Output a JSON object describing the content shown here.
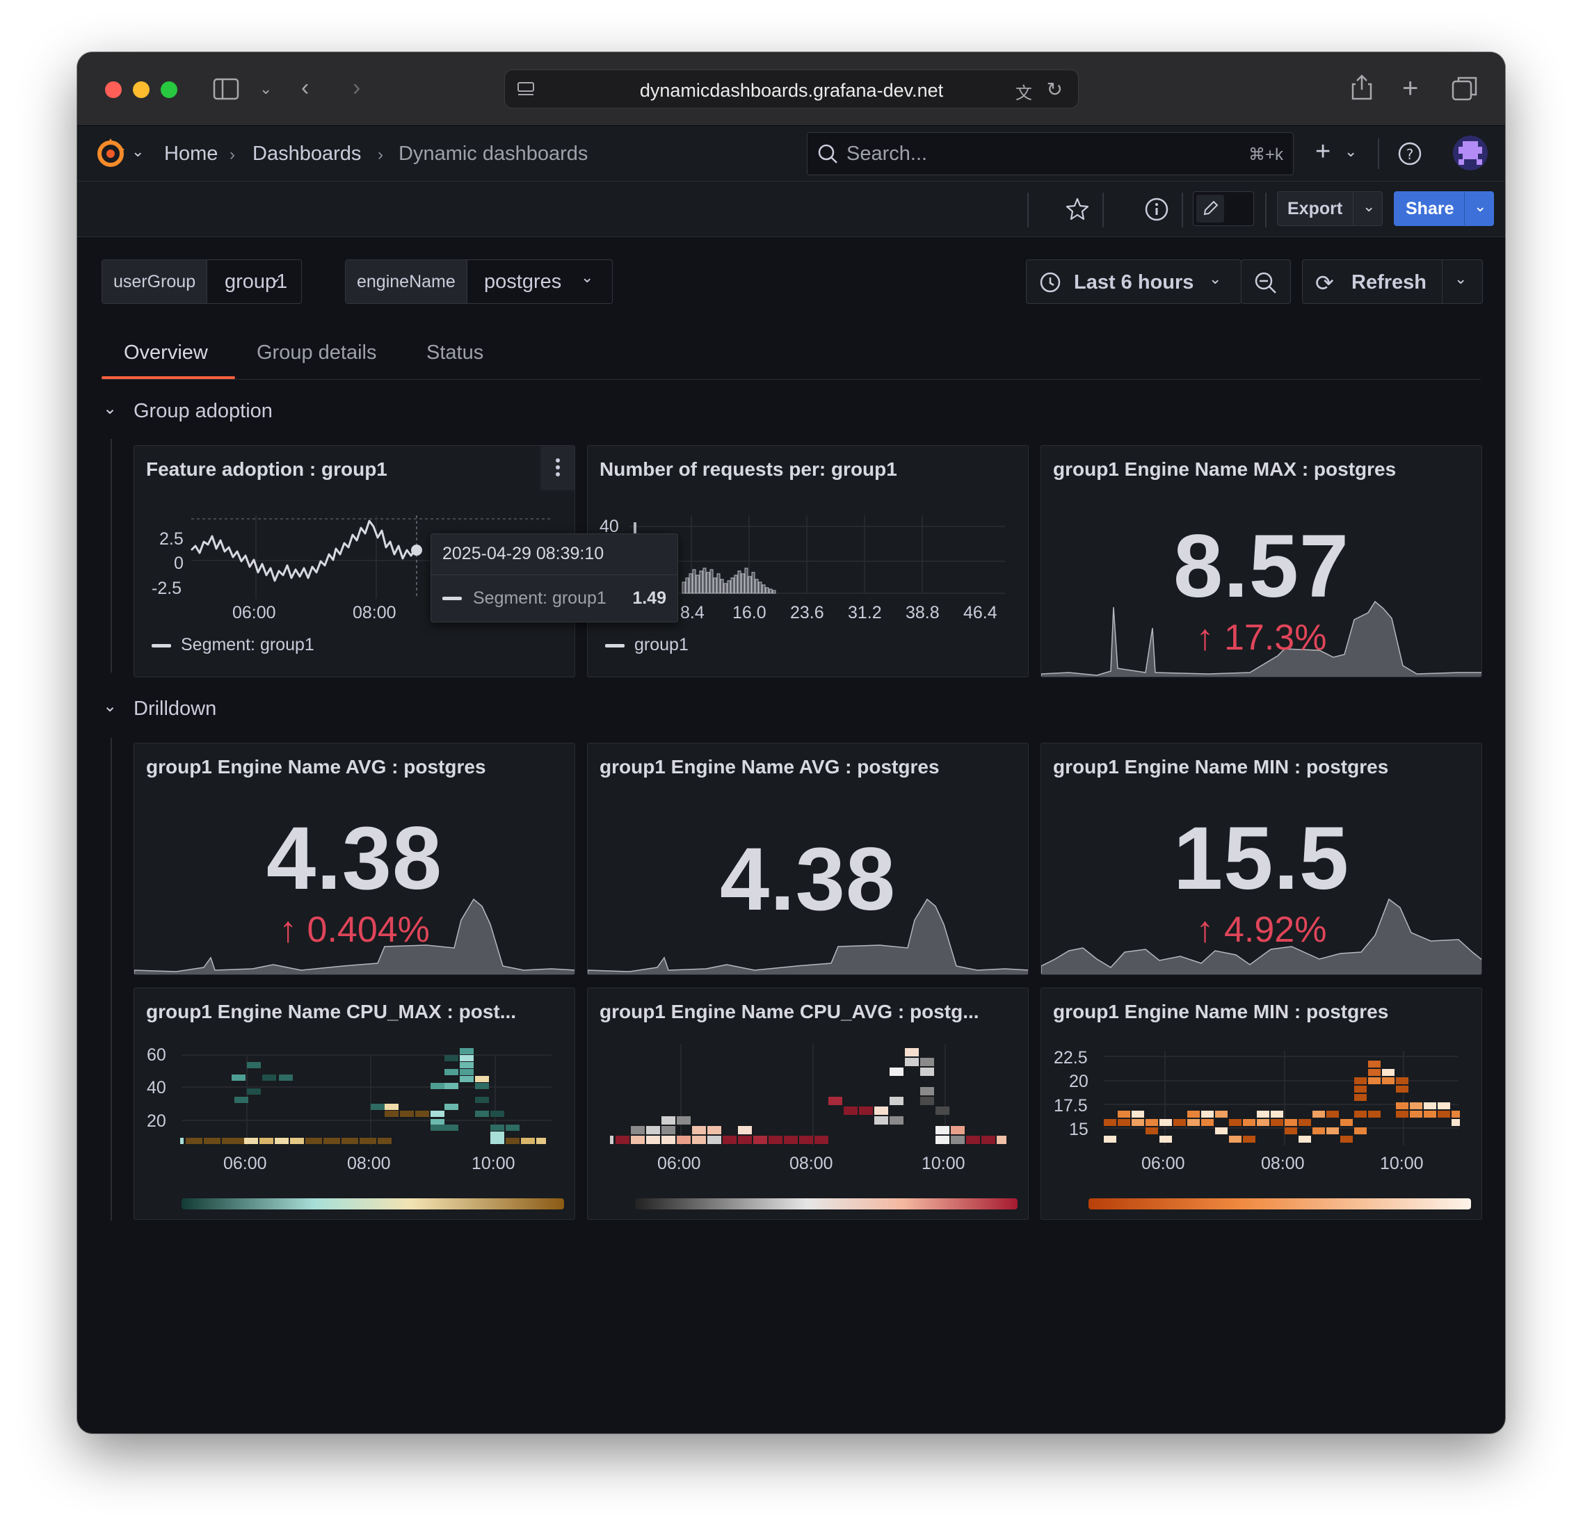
{
  "browser": {
    "url": "dynamicdashboards.grafana-dev.net"
  },
  "nav": {
    "breadcrumbs": [
      "Home",
      "Dashboards",
      "Dynamic dashboards"
    ],
    "search_placeholder": "Search...",
    "search_shortcut": "⌘+k"
  },
  "toolbar": {
    "export_label": "Export",
    "share_label": "Share"
  },
  "variables": [
    {
      "name": "userGroup",
      "value": "group1"
    },
    {
      "name": "engineName",
      "value": "postgres"
    }
  ],
  "time_range": {
    "label": "Last 6 hours",
    "refresh_label": "Refresh"
  },
  "tabs": [
    "Overview",
    "Group details",
    "Status"
  ],
  "active_tab": "Overview",
  "sections": {
    "group_adoption": "Group adoption",
    "drilldown": "Drilldown"
  },
  "panels": {
    "feature_adoption": {
      "title": "Feature adoption : group1",
      "y_ticks": [
        "2.5",
        "0",
        "-2.5"
      ],
      "x_ticks": [
        "06:00",
        "08:00"
      ],
      "legend": "Segment: group1"
    },
    "tooltip": {
      "time": "2025-04-29 08:39:10",
      "series": "Segment: group1",
      "value": "1.49"
    },
    "requests": {
      "title": "Number of requests per: group1",
      "y_ticks": [
        "40"
      ],
      "x_ticks": [
        "8.4",
        "16.0",
        "23.6",
        "31.2",
        "38.8",
        "46.4"
      ],
      "legend": "group1"
    },
    "max_stat": {
      "title": "group1 Engine Name MAX : postgres",
      "value": "8.57",
      "delta": "17.3%"
    },
    "avg_stat_1": {
      "title": "group1 Engine Name AVG : postgres",
      "value": "4.38",
      "delta": "0.404%"
    },
    "avg_stat_2": {
      "title": "group1 Engine Name AVG : postgres",
      "value": "4.38"
    },
    "min_stat": {
      "title": "group1 Engine Name MIN : postgres",
      "value": "15.5",
      "delta": "4.92%"
    },
    "cpu_max_heatmap": {
      "title": "group1 Engine Name CPU_MAX : post...",
      "y_ticks": [
        "60",
        "40",
        "20"
      ],
      "x_ticks": [
        "06:00",
        "08:00",
        "10:00"
      ]
    },
    "cpu_avg_heatmap": {
      "title": "group1 Engine Name CPU_AVG : postg...",
      "x_ticks": [
        "06:00",
        "08:00",
        "10:00"
      ]
    },
    "min_heatmap": {
      "title": "group1 Engine Name MIN : postgres",
      "y_ticks": [
        "22.5",
        "20",
        "17.5",
        "15"
      ],
      "x_ticks": [
        "06:00",
        "08:00",
        "10:00"
      ]
    }
  },
  "colors": {
    "accent_blue": "#3d71d9",
    "negative_red": "#e0455a",
    "tab_underline": "#f55f3e",
    "panel_bg": "#181b1f"
  }
}
